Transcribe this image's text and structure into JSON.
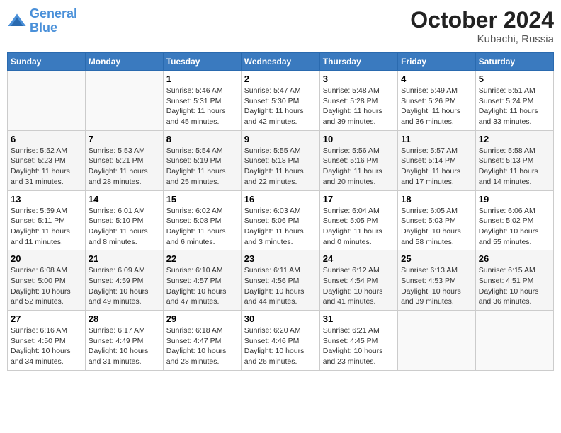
{
  "header": {
    "logo": {
      "line1": "General",
      "line2": "Blue"
    },
    "month": "October 2024",
    "location": "Kubachi, Russia"
  },
  "weekdays": [
    "Sunday",
    "Monday",
    "Tuesday",
    "Wednesday",
    "Thursday",
    "Friday",
    "Saturday"
  ],
  "weeks": [
    [
      {
        "day": null,
        "info": null
      },
      {
        "day": null,
        "info": null
      },
      {
        "day": "1",
        "info": "Sunrise: 5:46 AM\nSunset: 5:31 PM\nDaylight: 11 hours and 45 minutes."
      },
      {
        "day": "2",
        "info": "Sunrise: 5:47 AM\nSunset: 5:30 PM\nDaylight: 11 hours and 42 minutes."
      },
      {
        "day": "3",
        "info": "Sunrise: 5:48 AM\nSunset: 5:28 PM\nDaylight: 11 hours and 39 minutes."
      },
      {
        "day": "4",
        "info": "Sunrise: 5:49 AM\nSunset: 5:26 PM\nDaylight: 11 hours and 36 minutes."
      },
      {
        "day": "5",
        "info": "Sunrise: 5:51 AM\nSunset: 5:24 PM\nDaylight: 11 hours and 33 minutes."
      }
    ],
    [
      {
        "day": "6",
        "info": "Sunrise: 5:52 AM\nSunset: 5:23 PM\nDaylight: 11 hours and 31 minutes."
      },
      {
        "day": "7",
        "info": "Sunrise: 5:53 AM\nSunset: 5:21 PM\nDaylight: 11 hours and 28 minutes."
      },
      {
        "day": "8",
        "info": "Sunrise: 5:54 AM\nSunset: 5:19 PM\nDaylight: 11 hours and 25 minutes."
      },
      {
        "day": "9",
        "info": "Sunrise: 5:55 AM\nSunset: 5:18 PM\nDaylight: 11 hours and 22 minutes."
      },
      {
        "day": "10",
        "info": "Sunrise: 5:56 AM\nSunset: 5:16 PM\nDaylight: 11 hours and 20 minutes."
      },
      {
        "day": "11",
        "info": "Sunrise: 5:57 AM\nSunset: 5:14 PM\nDaylight: 11 hours and 17 minutes."
      },
      {
        "day": "12",
        "info": "Sunrise: 5:58 AM\nSunset: 5:13 PM\nDaylight: 11 hours and 14 minutes."
      }
    ],
    [
      {
        "day": "13",
        "info": "Sunrise: 5:59 AM\nSunset: 5:11 PM\nDaylight: 11 hours and 11 minutes."
      },
      {
        "day": "14",
        "info": "Sunrise: 6:01 AM\nSunset: 5:10 PM\nDaylight: 11 hours and 8 minutes."
      },
      {
        "day": "15",
        "info": "Sunrise: 6:02 AM\nSunset: 5:08 PM\nDaylight: 11 hours and 6 minutes."
      },
      {
        "day": "16",
        "info": "Sunrise: 6:03 AM\nSunset: 5:06 PM\nDaylight: 11 hours and 3 minutes."
      },
      {
        "day": "17",
        "info": "Sunrise: 6:04 AM\nSunset: 5:05 PM\nDaylight: 11 hours and 0 minutes."
      },
      {
        "day": "18",
        "info": "Sunrise: 6:05 AM\nSunset: 5:03 PM\nDaylight: 10 hours and 58 minutes."
      },
      {
        "day": "19",
        "info": "Sunrise: 6:06 AM\nSunset: 5:02 PM\nDaylight: 10 hours and 55 minutes."
      }
    ],
    [
      {
        "day": "20",
        "info": "Sunrise: 6:08 AM\nSunset: 5:00 PM\nDaylight: 10 hours and 52 minutes."
      },
      {
        "day": "21",
        "info": "Sunrise: 6:09 AM\nSunset: 4:59 PM\nDaylight: 10 hours and 49 minutes."
      },
      {
        "day": "22",
        "info": "Sunrise: 6:10 AM\nSunset: 4:57 PM\nDaylight: 10 hours and 47 minutes."
      },
      {
        "day": "23",
        "info": "Sunrise: 6:11 AM\nSunset: 4:56 PM\nDaylight: 10 hours and 44 minutes."
      },
      {
        "day": "24",
        "info": "Sunrise: 6:12 AM\nSunset: 4:54 PM\nDaylight: 10 hours and 41 minutes."
      },
      {
        "day": "25",
        "info": "Sunrise: 6:13 AM\nSunset: 4:53 PM\nDaylight: 10 hours and 39 minutes."
      },
      {
        "day": "26",
        "info": "Sunrise: 6:15 AM\nSunset: 4:51 PM\nDaylight: 10 hours and 36 minutes."
      }
    ],
    [
      {
        "day": "27",
        "info": "Sunrise: 6:16 AM\nSunset: 4:50 PM\nDaylight: 10 hours and 34 minutes."
      },
      {
        "day": "28",
        "info": "Sunrise: 6:17 AM\nSunset: 4:49 PM\nDaylight: 10 hours and 31 minutes."
      },
      {
        "day": "29",
        "info": "Sunrise: 6:18 AM\nSunset: 4:47 PM\nDaylight: 10 hours and 28 minutes."
      },
      {
        "day": "30",
        "info": "Sunrise: 6:20 AM\nSunset: 4:46 PM\nDaylight: 10 hours and 26 minutes."
      },
      {
        "day": "31",
        "info": "Sunrise: 6:21 AM\nSunset: 4:45 PM\nDaylight: 10 hours and 23 minutes."
      },
      {
        "day": null,
        "info": null
      },
      {
        "day": null,
        "info": null
      }
    ]
  ]
}
